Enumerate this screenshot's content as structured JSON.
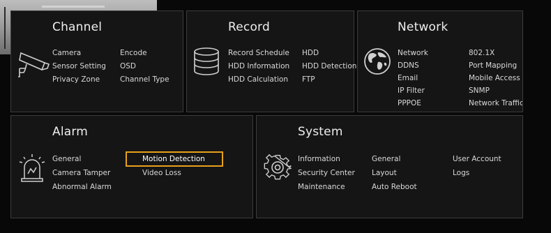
{
  "channel": {
    "title": "Channel",
    "col1": [
      "Camera",
      "Sensor Setting",
      "Privacy Zone"
    ],
    "col2": [
      "Encode",
      "OSD",
      "Channel Type"
    ]
  },
  "record": {
    "title": "Record",
    "col1": [
      "Record Schedule",
      "HDD Information",
      "HDD Calculation"
    ],
    "col2": [
      "HDD",
      "HDD Detection",
      "FTP"
    ]
  },
  "network": {
    "title": "Network",
    "col1": [
      "Network",
      "DDNS",
      "Email",
      "IP Filter",
      "PPPOE"
    ],
    "col2": [
      "802.1X",
      "Port Mapping",
      "Mobile Access",
      "SNMP",
      "Network Traffic"
    ]
  },
  "alarm": {
    "title": "Alarm",
    "col1": [
      "General",
      "Camera Tamper",
      "Abnormal Alarm"
    ],
    "col2": [
      "Motion Detection",
      "Video Loss"
    ],
    "selected": "Motion Detection"
  },
  "system": {
    "title": "System",
    "col1": [
      "Information",
      "Security Center",
      "Maintenance"
    ],
    "col2": [
      "General",
      "Layout",
      "Auto Reboot"
    ],
    "col3": [
      "User Account",
      "Logs"
    ]
  },
  "icons": {
    "channel": "camera-icon",
    "record": "hdd-stack-icon",
    "network": "globe-icon",
    "alarm": "alarm-beacon-icon",
    "system": "gear-icon"
  },
  "colors": {
    "panel_bg": "#151515",
    "panel_border": "#3c3c3c",
    "highlight": "#e6a21a"
  }
}
